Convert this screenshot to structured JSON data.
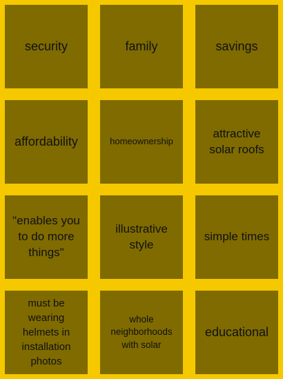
{
  "tiles": [
    {
      "label": "security"
    },
    {
      "label": "family"
    },
    {
      "label": "savings"
    },
    {
      "label": "affordability"
    },
    {
      "label": "homeownership"
    },
    {
      "label": "attractive solar roofs"
    },
    {
      "label": "\"enables you to do more things\""
    },
    {
      "label": "illustrative style"
    },
    {
      "label": "simple times"
    },
    {
      "label": "must be wearing helmets in installation photos"
    },
    {
      "label": "whole neighborhoods with solar"
    },
    {
      "label": "educational"
    }
  ],
  "colors": {
    "background": "#f5c800",
    "tile": "#7f6b00",
    "text": "#111111"
  }
}
